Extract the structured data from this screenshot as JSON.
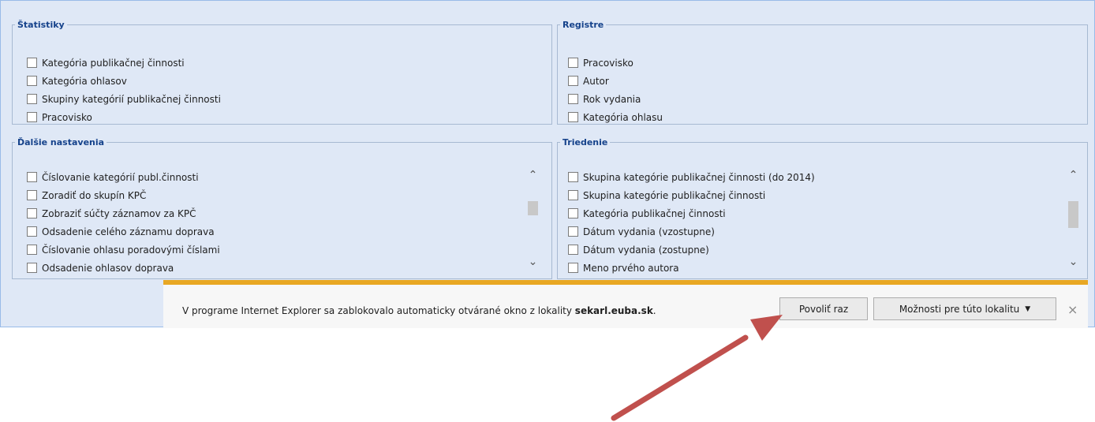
{
  "statistiky": {
    "legend": "Štatistiky",
    "items": [
      "Kategória publikačnej činnosti",
      "Kategória ohlasov",
      "Skupiny kategórií publikačnej činnosti",
      "Pracovisko"
    ]
  },
  "registre": {
    "legend": "Registre",
    "items": [
      "Pracovisko",
      "Autor",
      "Rok vydania",
      "Kategória ohlasu"
    ]
  },
  "dalsie": {
    "legend": "Ďalšie nastavenia",
    "items": [
      "Číslovanie kategórií publ.činnosti",
      "Zoradiť do skupín KPČ",
      "Zobraziť súčty záznamov za KPČ",
      "Odsadenie celého záznamu doprava",
      "Číslovanie ohlasu poradovými číslami",
      "Odsadenie ohlasov doprava"
    ]
  },
  "triedenie": {
    "legend": "Triedenie",
    "items": [
      "Skupina kategórie publikačnej činnosti (do 2014)",
      "Skupina kategórie publikačnej činnosti",
      "Kategória publikačnej činnosti",
      "Dátum vydania (vzostupne)",
      "Dátum vydania (zostupne)",
      "Meno prvého autora"
    ]
  },
  "ie_bar": {
    "message_prefix": "V programe Internet Explorer sa zablokovalo automaticky otvárané okno z lokality ",
    "domain": "sekarl.euba.sk",
    "message_suffix": ".",
    "allow_once": "Povoliť raz",
    "site_options": "Možnosti pre túto lokalitu",
    "close": "×"
  },
  "colors": {
    "app_bg": "#dfe8f6",
    "legend": "#15428b",
    "ie_accent": "#e8a723",
    "arrow": "#c0504d"
  }
}
